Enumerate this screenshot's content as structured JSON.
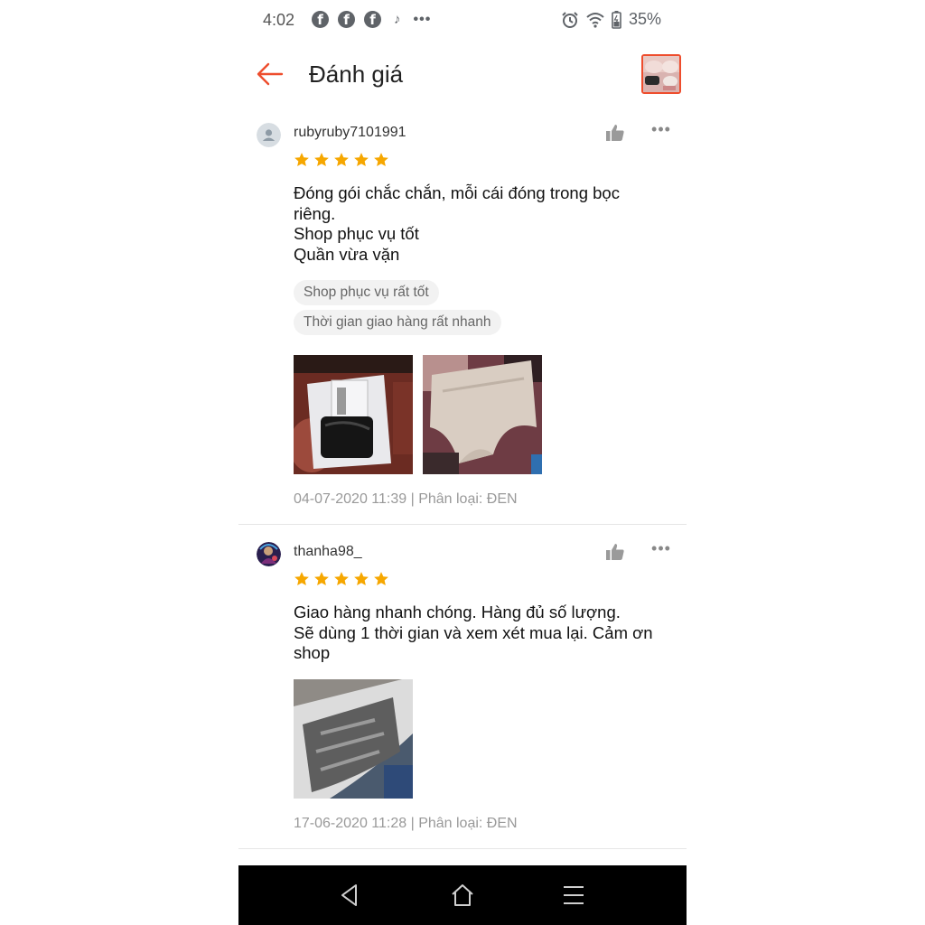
{
  "status_bar": {
    "time": "4:02",
    "battery": "35%",
    "left_icons": [
      "facebook-icon",
      "facebook-icon",
      "facebook-icon",
      "tiktok-icon",
      "more-dots-icon"
    ],
    "right_icons": [
      "alarm-icon",
      "wifi-icon",
      "battery-icon"
    ]
  },
  "header": {
    "title": "Đánh giá",
    "back_icon": "back-arrow-icon",
    "accent_color": "#ee4d2d"
  },
  "reviews": [
    {
      "username": "rubyruby7101991",
      "rating": 5,
      "lines": [
        "Đóng gói chắc chắn, mỗi cái đóng trong bọc",
        "riêng.",
        "Shop phục vụ tốt",
        "Quần vừa vặn"
      ],
      "tags": [
        "Shop phục vụ rất tốt",
        "Thời gian giao hàng rất nhanh"
      ],
      "meta": "04-07-2020 11:39 | Phân loại: ĐEN"
    },
    {
      "username": "thanha98_",
      "rating": 5,
      "lines": [
        "Giao hàng nhanh chóng. Hàng đủ số lượng.",
        "Sẽ dùng 1 thời gian và xem xét mua lại. Cảm ơn",
        "shop"
      ],
      "tags": [],
      "meta": "17-06-2020 11:28 | Phân loại: ĐEN"
    }
  ],
  "star_color": "#f6a700",
  "nav_bar": {
    "icons": [
      "nav-back-icon",
      "nav-home-icon",
      "nav-menu-icon"
    ]
  }
}
